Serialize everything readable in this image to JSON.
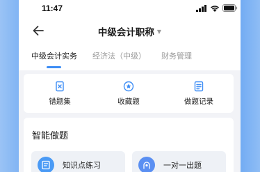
{
  "status_bar": {
    "time": "11:47"
  },
  "nav": {
    "title": "中级会计职称",
    "title_dropdown_icon": "caret-down-icon",
    "back_icon": "back-arrow-icon"
  },
  "tabs": [
    {
      "label": "中级会计实务",
      "active": true
    },
    {
      "label": "经济法（中级）",
      "active": false
    },
    {
      "label": "财务管理",
      "active": false
    }
  ],
  "quick_actions": [
    {
      "label": "错题集",
      "icon": "error-book-icon"
    },
    {
      "label": "收藏题",
      "icon": "star-favorite-icon"
    },
    {
      "label": "做题记录",
      "icon": "record-list-icon"
    }
  ],
  "smart_practice": {
    "title": "智能做题",
    "tiles": [
      {
        "label": "知识点练习",
        "icon": "knowledge-point-icon"
      },
      {
        "label": "一对一出题",
        "icon": "one-on-one-icon"
      }
    ]
  },
  "colors": {
    "accent": "#3d8df5",
    "background_blue": "#5a9df1"
  }
}
